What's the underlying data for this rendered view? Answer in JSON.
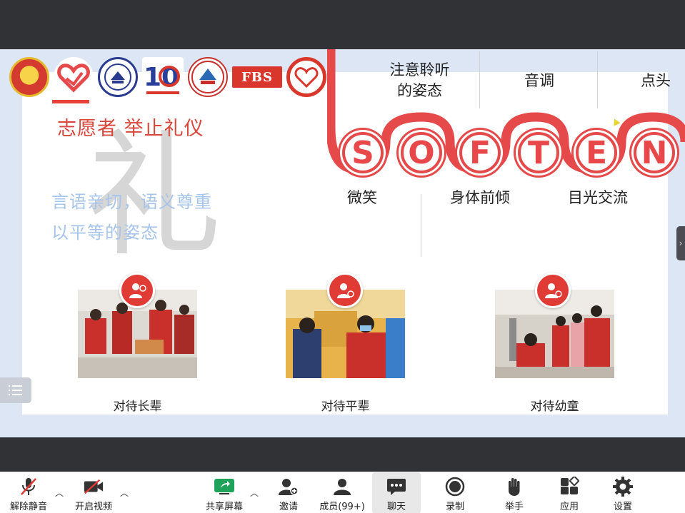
{
  "slide": {
    "title": "志愿者   举止礼仪",
    "big_character": "礼",
    "blue_lines": [
      "言语亲切，语义尊重",
      "以平等的姿态"
    ],
    "top_topics": [
      "注意聆听\n的姿态",
      "音调",
      "点头"
    ],
    "soften_letters": [
      "S",
      "O",
      "F",
      "T",
      "E",
      "N"
    ],
    "bottom_topics": [
      "微笑",
      "身体前倾",
      "目光交流"
    ],
    "photos": [
      {
        "caption": "对待长辈",
        "icon": "elder-service-icon"
      },
      {
        "caption": "对待平辈",
        "icon": "peer-service-icon"
      },
      {
        "caption": "对待幼童",
        "icon": "child-service-icon"
      }
    ],
    "logos": [
      {
        "name": "youth-league-emblem"
      },
      {
        "name": "volunteer-heart-logo"
      },
      {
        "name": "university-seal-logo"
      },
      {
        "name": "tenth-anniversary-logo",
        "text": "10"
      },
      {
        "name": "institute-round-logo"
      },
      {
        "name": "fbs-logo",
        "text": "FBS"
      },
      {
        "name": "volunteer-association-logo"
      }
    ],
    "accent_color": "#e6494a"
  },
  "toolbar": {
    "items": [
      {
        "label": "解除静音",
        "icon": "microphone-muted-icon"
      },
      {
        "label": "开启视频",
        "icon": "video-off-icon"
      },
      {
        "label": "共享屏幕",
        "icon": "share-screen-icon"
      },
      {
        "label": "邀请",
        "icon": "invite-user-icon"
      },
      {
        "label": "成员(99+)",
        "icon": "members-icon"
      },
      {
        "label": "聊天",
        "icon": "chat-icon"
      },
      {
        "label": "录制",
        "icon": "record-icon"
      },
      {
        "label": "举手",
        "icon": "raise-hand-icon"
      },
      {
        "label": "应用",
        "icon": "apps-icon"
      },
      {
        "label": "设置",
        "icon": "settings-icon"
      }
    ]
  }
}
